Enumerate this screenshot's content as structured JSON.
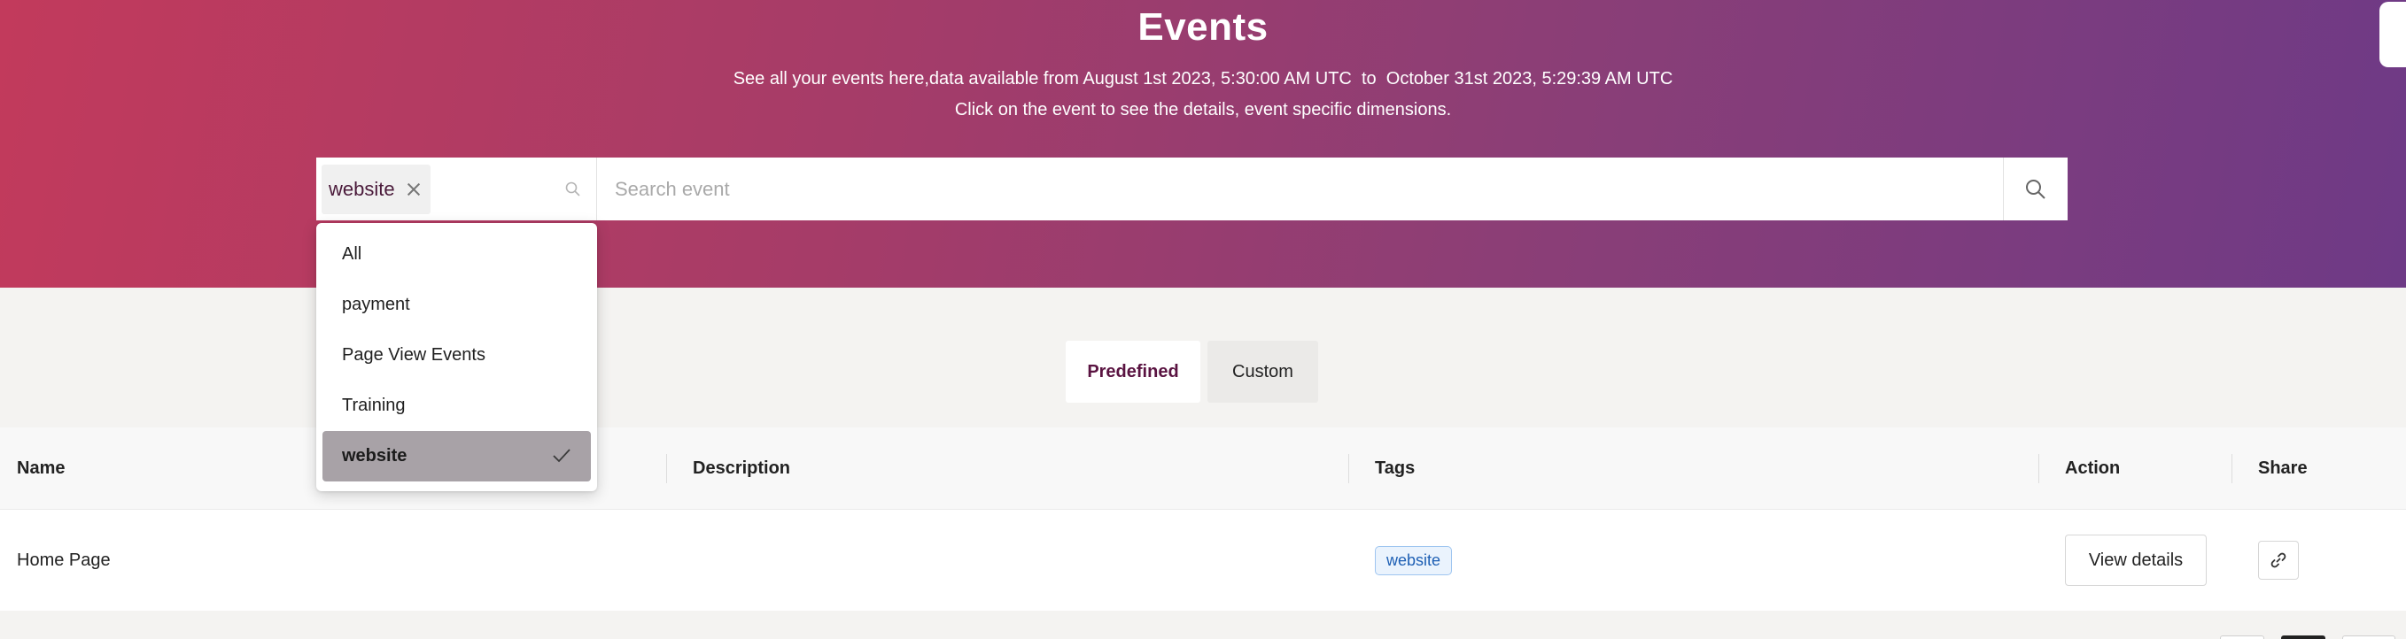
{
  "header": {
    "title": "Events",
    "subtitle_line1": "See all your events here,data available from August 1st 2023, 5:30:00 AM UTC  to  October 31st 2023, 5:29:39 AM UTC",
    "subtitle_line2": "Click on the event to see the details, event specific dimensions."
  },
  "search": {
    "selected_tag": "website",
    "placeholder": "Search event"
  },
  "tag_dropdown": {
    "options": [
      "All",
      "payment",
      "Page View Events",
      "Training",
      "website"
    ],
    "selected": "website"
  },
  "tabs": [
    {
      "label": "Predefined",
      "active": true
    },
    {
      "label": "Custom",
      "active": false
    }
  ],
  "table": {
    "columns": [
      "Name",
      "Description",
      "Tags",
      "Action",
      "Share"
    ],
    "rows": [
      {
        "name": "Home Page",
        "description": "",
        "tag": "website",
        "action": "View details"
      }
    ]
  },
  "colors": {
    "gradient_start": "#c23a5c",
    "gradient_end": "#6e3a86",
    "accent_text": "#5a1341",
    "tag_blue": "#1d5fb4"
  },
  "icons": {
    "search": "magnifier",
    "remove_chip": "close-x",
    "selected_option": "checkmark",
    "share": "link"
  }
}
